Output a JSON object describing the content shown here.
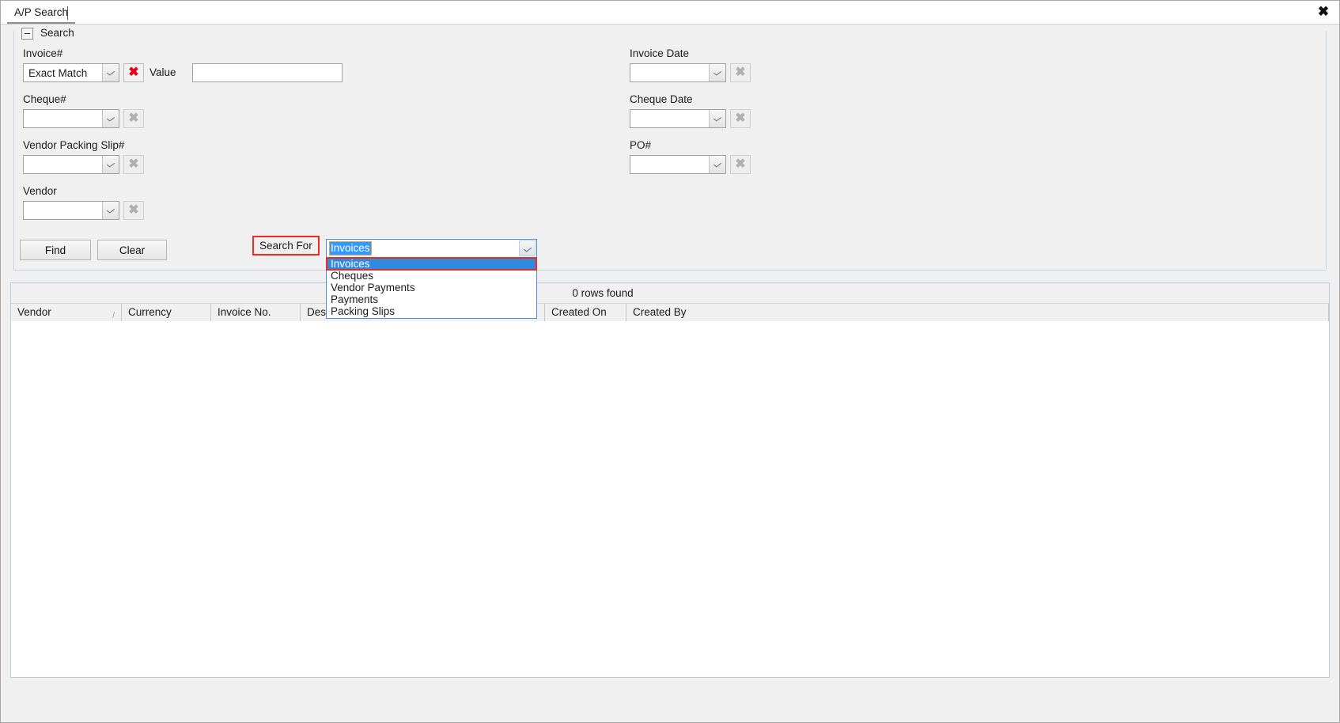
{
  "window": {
    "tab_label": "A/P Search",
    "close_icon": "close-icon"
  },
  "group": {
    "title": "Search",
    "toggle_state": "expanded"
  },
  "fields": {
    "invoice_no": {
      "label": "Invoice#",
      "match_mode": "Exact Match",
      "clear_enabled": true,
      "value_label": "Value",
      "value": "",
      "value_placeholder": ""
    },
    "cheque_no": {
      "label": "Cheque#",
      "value": "",
      "clear_enabled": false
    },
    "vendor_packing_slip": {
      "label": "Vendor Packing Slip#",
      "value": "",
      "clear_enabled": false
    },
    "vendor": {
      "label": "Vendor",
      "value": "",
      "clear_enabled": false
    },
    "invoice_date": {
      "label": "Invoice Date",
      "value": "",
      "clear_enabled": false
    },
    "cheque_date": {
      "label": "Cheque Date",
      "value": "",
      "clear_enabled": false
    },
    "po_no": {
      "label": "PO#",
      "value": "",
      "clear_enabled": false
    }
  },
  "actions": {
    "find_label": "Find",
    "clear_label": "Clear"
  },
  "search_for": {
    "label": "Search For",
    "selected": "Invoices",
    "open": true,
    "options": [
      "Invoices",
      "Cheques",
      "Vendor Payments",
      "Payments",
      "Packing Slips"
    ]
  },
  "results": {
    "rows_found_text": "0 rows found",
    "columns": [
      {
        "label": "Vendor",
        "sorted": true,
        "sort_glyph": "/"
      },
      {
        "label": "Currency",
        "sorted": false,
        "sort_glyph": ""
      },
      {
        "label": "Invoice No.",
        "sorted": false,
        "sort_glyph": ""
      },
      {
        "label": "Description",
        "sorted": false,
        "sort_glyph": ""
      },
      {
        "label": "Created On",
        "sorted": false,
        "sort_glyph": ""
      },
      {
        "label": "Created By",
        "sorted": false,
        "sort_glyph": ""
      }
    ],
    "rows": []
  },
  "colors": {
    "highlight_red": "#ee2a22",
    "selection_blue": "#2f8ae0",
    "clear_icon_red": "#e2001a",
    "panel_gray": "#f0f0f0"
  }
}
